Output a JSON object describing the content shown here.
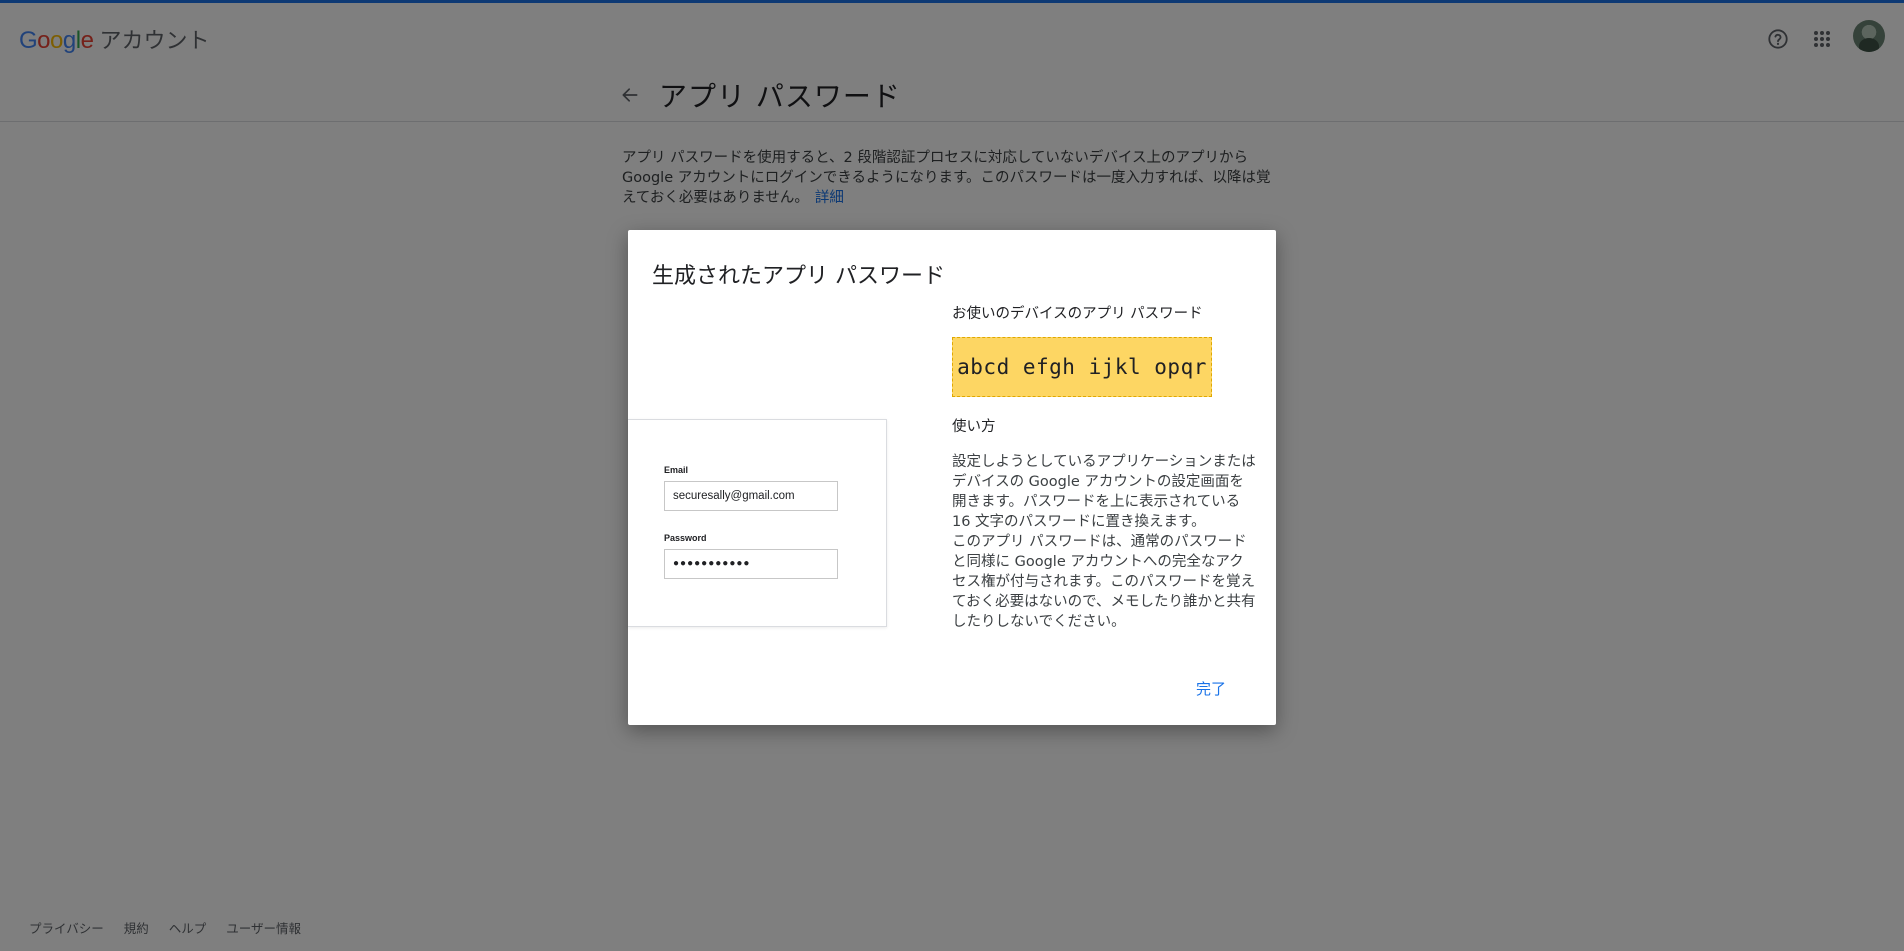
{
  "header": {
    "logo_text": "Google",
    "product_name": "アカウント",
    "help_icon": "help-circle-icon",
    "apps_icon": "apps-grid-icon",
    "avatar": "user-avatar"
  },
  "page": {
    "title": "アプリ パスワード",
    "intro_text": "アプリ パスワードを使用すると、2 段階認証プロセスに対応していないデバイス上のアプリから Google アカウントにログインできるようになります。このパスワードは一度入力すれば、以降は覚えておく必要はありません。",
    "learn_more": "詳細"
  },
  "dialog": {
    "title": "生成されたアプリ パスワード",
    "device_label": "お使いのデバイスのアプリ パスワード",
    "password": "abcd efgh ijkl opqr",
    "how_to_title": "使い方",
    "instruction_1": "設定しようとしているアプリケーションまたはデバイスの Google アカウントの設定画面を開きます。パスワードを上に表示されている 16 文字のパスワードに置き換えます。",
    "instruction_2": "このアプリ パスワードは、通常のパスワードと同様に Google アカウントへの完全なアクセス権が付与されます。このパスワードを覚えておく必要はないので、メモしたり誰かと共有したりしないでください。",
    "done_label": "完了",
    "illustration": {
      "email_label": "Email",
      "email_value": "securesally@gmail.com",
      "password_label": "Password",
      "password_value": "●●●●●●●●●●●"
    }
  },
  "footer": {
    "links": [
      "プライバシー",
      "規約",
      "ヘルプ",
      "ユーザー情報"
    ]
  },
  "colors": {
    "accent": "#1a73e8",
    "password_highlight": "#fdd663",
    "scrim": "rgba(0,0,0,0.5)"
  }
}
